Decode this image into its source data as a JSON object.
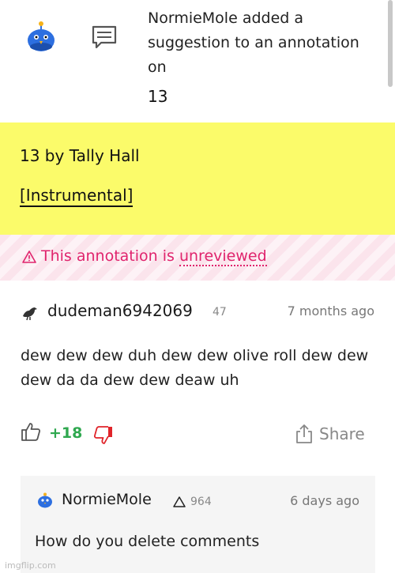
{
  "notification": {
    "text": "NormieMole added a suggestion to an annotation on",
    "song_ref": "13",
    "avatar_icon": "blue-bird-avatar",
    "type_icon": "comment-icon"
  },
  "highlight": {
    "title": "13 by Tally Hall",
    "lyric": "[Instrumental]",
    "background": "#fbfb6a"
  },
  "banner": {
    "icon": "warning-triangle-icon",
    "prefix": "This annotation is ",
    "link": "unreviewed",
    "color": "#e0246d"
  },
  "comment": {
    "username": "dudeman6942069",
    "iq": "47",
    "time": "7 months ago",
    "body": "dew dew dew duh dew dew olive roll dew dew dew da da dew dew deaw uh",
    "votes": "+18",
    "share_label": "Share"
  },
  "reply": {
    "username": "NormieMole",
    "iq": "964",
    "time": "6 days ago",
    "body": "How do you delete comments"
  },
  "watermark": "imgflip.com"
}
